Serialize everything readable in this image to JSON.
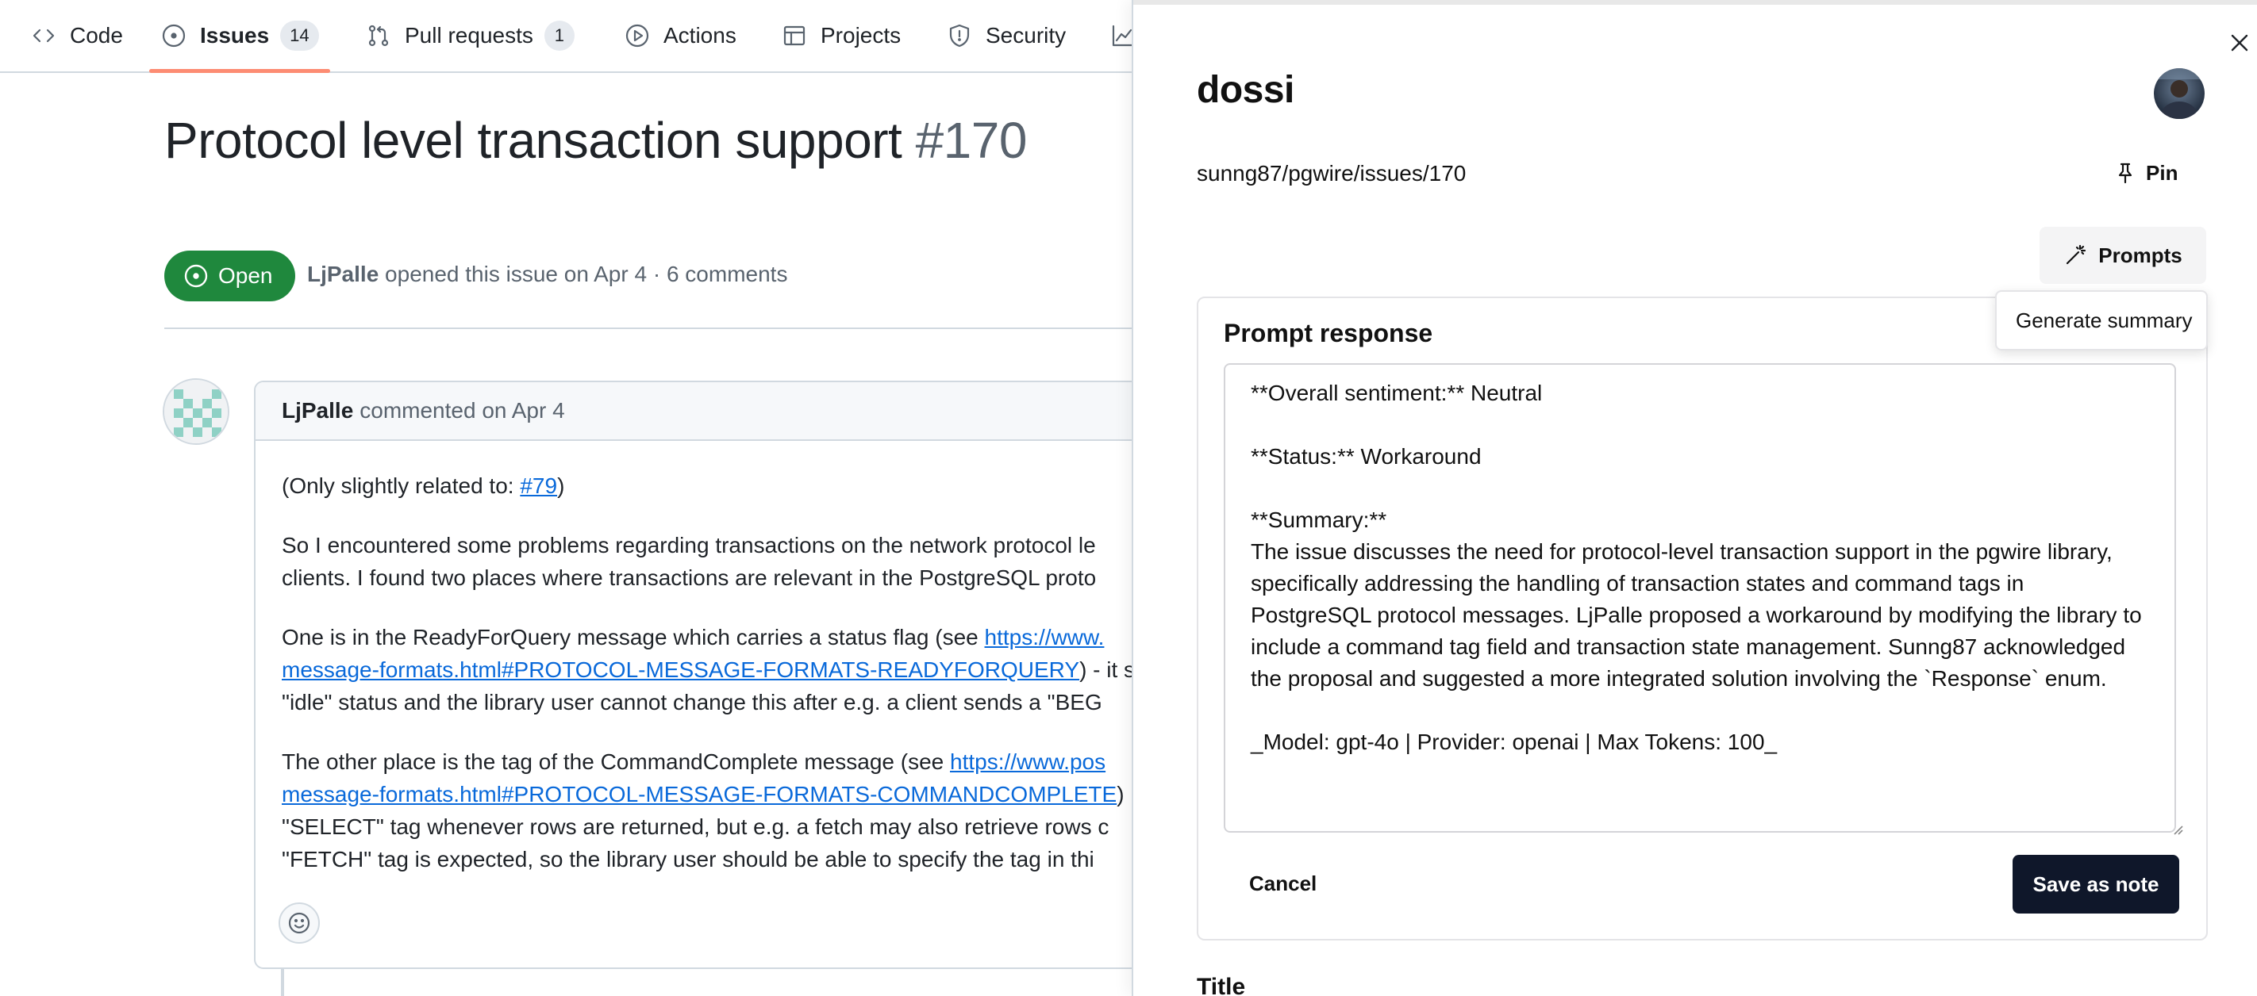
{
  "nav": {
    "tabs": [
      {
        "label": "Code",
        "icon": "code-icon"
      },
      {
        "label": "Issues",
        "count": "14",
        "icon": "issue-opened-icon",
        "active": true
      },
      {
        "label": "Pull requests",
        "count": "1",
        "icon": "git-pull-request-icon"
      },
      {
        "label": "Actions",
        "icon": "play-icon"
      },
      {
        "label": "Projects",
        "icon": "table-icon"
      },
      {
        "label": "Security",
        "icon": "shield-icon"
      }
    ]
  },
  "issue": {
    "title": "Protocol level transaction support",
    "number": "#170",
    "state": "Open",
    "author": "LjPalle",
    "meta": "opened this issue on Apr 4 · 6 comments"
  },
  "comment": {
    "author": "LjPalle",
    "meta": "commented on Apr 4",
    "p1_text": "(Only slightly related to: ",
    "p1_link": "#79",
    "p1_end": ")",
    "p2_l1": "So I encountered some problems regarding transactions on the network protocol le",
    "p2_l2": "clients. I found two places where transactions are relevant in the PostgreSQL proto",
    "p3_l1_text": "One is in the ReadyForQuery message which carries a status flag (see ",
    "p3_l1_link": "https://www.",
    "p3_l2_link": "message-formats.html#PROTOCOL-MESSAGE-FORMATS-READYFORQUERY",
    "p3_l2_text": ") - it s",
    "p3_l3": "\"idle\" status and the library user cannot change this after e.g. a client sends a \"BEG",
    "p4_l1_text": "The other place is the tag of the CommandComplete message (see ",
    "p4_l1_link": "https://www.pos",
    "p4_l2_link": "message-formats.html#PROTOCOL-MESSAGE-FORMATS-COMMANDCOMPLETE",
    "p4_l2_text": ")",
    "p4_l3": "\"SELECT\" tag whenever rows are returned, but e.g. a fetch may also retrieve rows c",
    "p4_l4": "\"FETCH\" tag is expected, so the library user should be able to specify the tag in thi"
  },
  "panel": {
    "title": "dossi",
    "path": "sunng87/pgwire/issues/170",
    "pin_label": "Pin",
    "prompts_label": "Prompts",
    "popover_item": "Generate summary",
    "card_title": "Prompt response",
    "response_text": "**Overall sentiment:** Neutral\n\n**Status:** Workaround\n\n**Summary:**\nThe issue discusses the need for protocol-level transaction support in the pgwire library, specifically addressing the handling of transaction states and command tags in PostgreSQL protocol messages. LjPalle proposed a workaround by modifying the library to include a command tag field and transaction state management. Sunng87 acknowledged the proposal and suggested a more integrated solution involving the `Response` enum.\n\n_Model: gpt-4o | Provider: openai | Max Tokens: 100_",
    "cancel_label": "Cancel",
    "save_label": "Save as note",
    "next_field_label": "Title"
  },
  "colors": {
    "open_green": "#1f883d",
    "link_blue": "#0969da",
    "active_tab_underline": "#fd8c73",
    "save_button": "#0f172a"
  }
}
